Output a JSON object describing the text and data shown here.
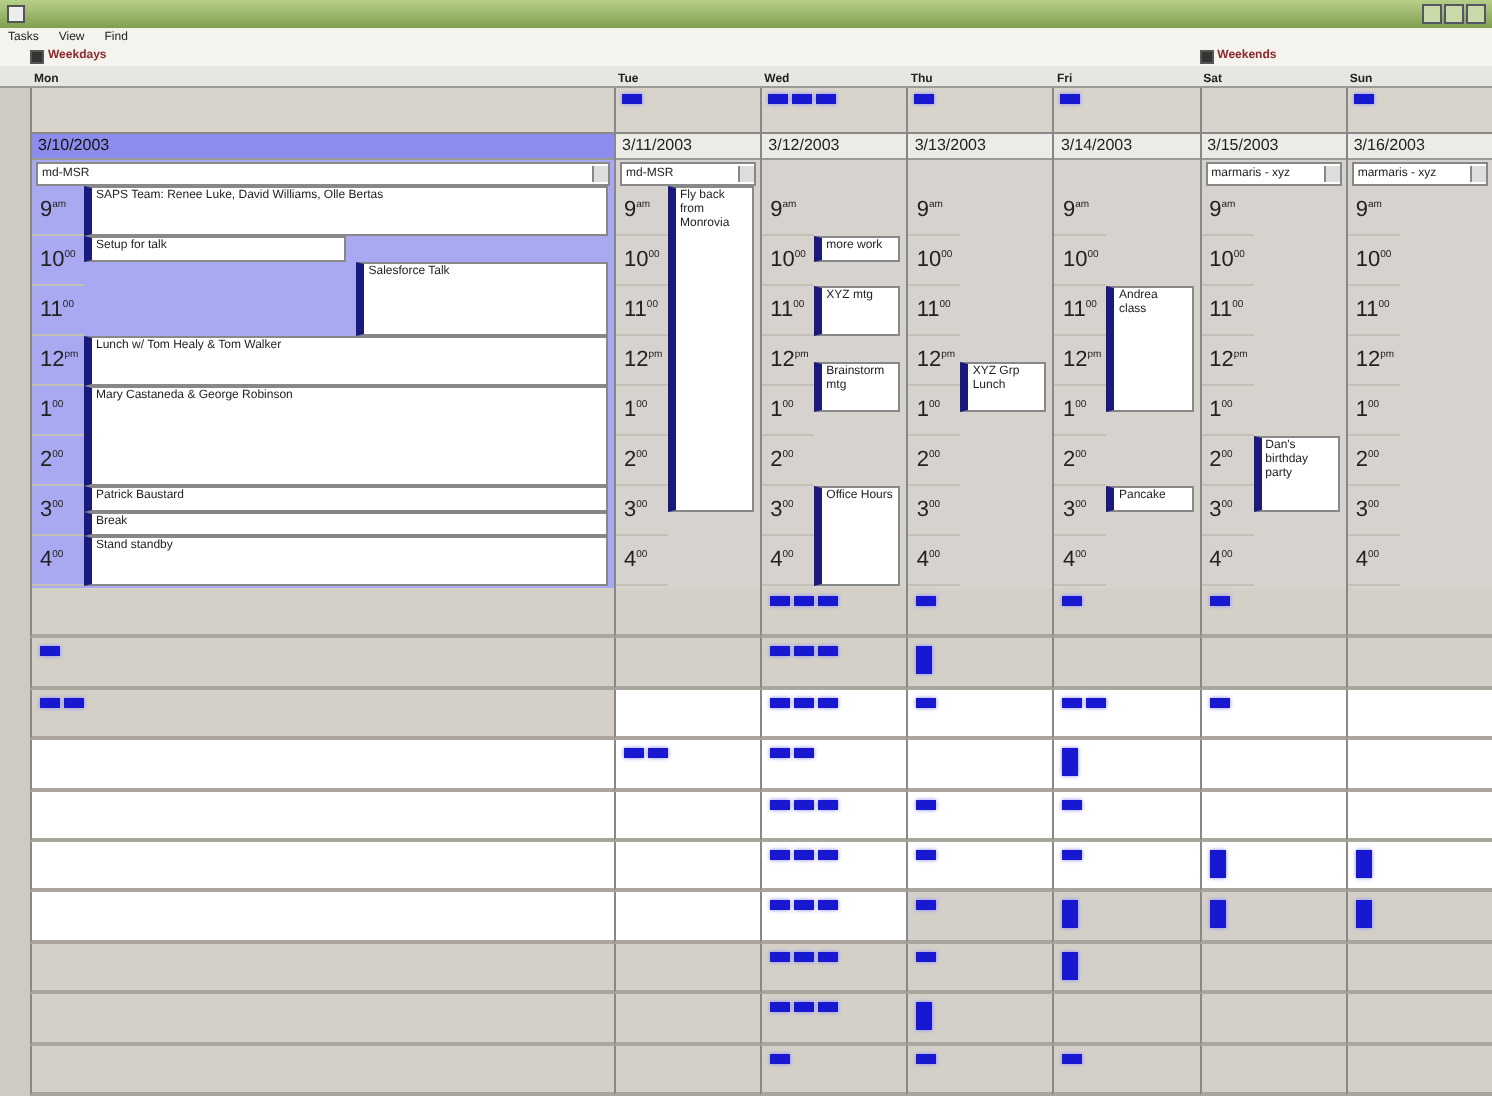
{
  "menu": [
    "Tasks",
    "View",
    "Find"
  ],
  "filters": [
    {
      "label": "Weekdays",
      "checked": true
    },
    {
      "label": "Weekends",
      "checked": true
    }
  ],
  "days": [
    {
      "name": "Mon",
      "date": "3/10/2003",
      "selected": true,
      "field": "md-MSR",
      "hours": [
        "9$^{am}$",
        "10$^{00}$",
        "11$^{00}$",
        "12$^{pm}$",
        "1$^{00}$",
        "2$^{00}$",
        "3$^{00}$",
        "4$^{00}$"
      ],
      "slots": [
        {
          "kind": "event",
          "title": "SAPS Team: Renee Luke, David Williams, Olle Bertas"
        },
        {
          "kind": "more"
        },
        {
          "kind": "half",
          "title": "Setup for talk"
        },
        {
          "kind": "side",
          "title": "Salesforce Talk"
        },
        {
          "kind": "more"
        },
        {
          "kind": "more"
        },
        {
          "kind": "event",
          "title": "Lunch w/ Tom Healy & Tom Walker"
        },
        {
          "kind": "more"
        },
        {
          "kind": "event",
          "title": "Mary Castaneda & George Robinson"
        },
        {
          "kind": "more"
        },
        {
          "kind": "more"
        },
        {
          "kind": "more"
        },
        {
          "kind": "event",
          "title": "Patrick Baustard"
        },
        {
          "kind": "event",
          "title": "Break"
        },
        {
          "kind": "event",
          "title": "Stand standby"
        },
        {
          "kind": "more"
        }
      ]
    },
    {
      "name": "Tue",
      "date": "3/11/2003",
      "selected": false,
      "field": "md-MSR",
      "allday": [
        {
          "kind": "block"
        }
      ],
      "hours": [
        "9$^{am}$",
        "10$^{00}$",
        "11$^{00}$",
        "12$^{pm}$",
        "1$^{00}$",
        "2$^{00}$",
        "3$^{00}$",
        "4$^{00}$"
      ],
      "slots": [
        {
          "kind": "event",
          "title": "Fly back from Monrovia"
        },
        {
          "kind": "more"
        },
        {
          "kind": "more"
        },
        {
          "kind": "more"
        },
        {
          "kind": "more"
        },
        {
          "kind": "more"
        },
        {
          "kind": "more"
        },
        {
          "kind": "more"
        },
        {
          "kind": "more"
        },
        {
          "kind": "more"
        },
        {
          "kind": "more"
        },
        {
          "kind": "more"
        },
        {
          "kind": "more"
        },
        {
          "kind": "free"
        },
        {
          "kind": "free"
        },
        {
          "kind": "free"
        }
      ]
    },
    {
      "name": "Wed",
      "date": "3/12/2003",
      "selected": false,
      "allday": [
        {
          "kind": "block"
        },
        {
          "kind": "block"
        },
        {
          "kind": "block"
        }
      ],
      "hours": [
        "9$^{am}$",
        "10$^{00}$",
        "11$^{00}$",
        "12$^{pm}$",
        "1$^{00}$",
        "2$^{00}$",
        "3$^{00}$",
        "4$^{00}$"
      ],
      "slots": [
        {
          "kind": "free"
        },
        {
          "kind": "free"
        },
        {
          "kind": "event",
          "title": "more work"
        },
        {
          "kind": "free"
        },
        {
          "kind": "event",
          "title": "XYZ mtg"
        },
        {
          "kind": "more"
        },
        {
          "kind": "free"
        },
        {
          "kind": "event",
          "title": "Brainstorm mtg"
        },
        {
          "kind": "more"
        },
        {
          "kind": "free"
        },
        {
          "kind": "free"
        },
        {
          "kind": "free"
        },
        {
          "kind": "event",
          "title": "Office Hours"
        },
        {
          "kind": "more"
        },
        {
          "kind": "more"
        },
        {
          "kind": "more"
        }
      ]
    },
    {
      "name": "Thu",
      "date": "3/13/2003",
      "selected": false,
      "allday": [
        {
          "kind": "block"
        }
      ],
      "hours": [
        "9$^{am}$",
        "10$^{00}$",
        "11$^{00}$",
        "12$^{pm}$",
        "1$^{00}$",
        "2$^{00}$",
        "3$^{00}$",
        "4$^{00}$"
      ],
      "slots": [
        {
          "kind": "free"
        },
        {
          "kind": "free"
        },
        {
          "kind": "free"
        },
        {
          "kind": "free"
        },
        {
          "kind": "free"
        },
        {
          "kind": "free"
        },
        {
          "kind": "free"
        },
        {
          "kind": "event",
          "title": "XYZ Grp Lunch"
        },
        {
          "kind": "more"
        },
        {
          "kind": "free"
        },
        {
          "kind": "free"
        },
        {
          "kind": "free"
        },
        {
          "kind": "free"
        },
        {
          "kind": "free"
        },
        {
          "kind": "free"
        },
        {
          "kind": "free"
        }
      ]
    },
    {
      "name": "Fri",
      "date": "3/14/2003",
      "selected": false,
      "allday": [
        {
          "kind": "block"
        }
      ],
      "hours": [
        "9$^{am}$",
        "10$^{00}$",
        "11$^{00}$",
        "12$^{pm}$",
        "1$^{00}$",
        "2$^{00}$",
        "3$^{00}$",
        "4$^{00}$"
      ],
      "slots": [
        {
          "kind": "free"
        },
        {
          "kind": "free"
        },
        {
          "kind": "free"
        },
        {
          "kind": "free"
        },
        {
          "kind": "event",
          "title": "Andrea class"
        },
        {
          "kind": "more"
        },
        {
          "kind": "more"
        },
        {
          "kind": "more"
        },
        {
          "kind": "more"
        },
        {
          "kind": "free"
        },
        {
          "kind": "free"
        },
        {
          "kind": "free"
        },
        {
          "kind": "event",
          "title": "Pancake"
        },
        {
          "kind": "free"
        },
        {
          "kind": "free"
        },
        {
          "kind": "free"
        }
      ]
    },
    {
      "name": "Sat",
      "date": "3/15/2003",
      "selected": false,
      "field": "marmaris - xyz",
      "hours": [
        "9$^{am}$",
        "10$^{00}$",
        "11$^{00}$",
        "12$^{pm}$",
        "1$^{00}$",
        "2$^{00}$",
        "3$^{00}$",
        "4$^{00}$"
      ],
      "slots": [
        {
          "kind": "free"
        },
        {
          "kind": "free"
        },
        {
          "kind": "free"
        },
        {
          "kind": "free"
        },
        {
          "kind": "free"
        },
        {
          "kind": "free"
        },
        {
          "kind": "free"
        },
        {
          "kind": "free"
        },
        {
          "kind": "free"
        },
        {
          "kind": "free"
        },
        {
          "kind": "event",
          "title": "Dan's birthday party"
        },
        {
          "kind": "more"
        },
        {
          "kind": "more"
        },
        {
          "kind": "free"
        },
        {
          "kind": "free"
        },
        {
          "kind": "free"
        }
      ]
    },
    {
      "name": "Sun",
      "date": "3/16/2003",
      "selected": false,
      "field": "marmaris - xyz",
      "allday": [
        {
          "kind": "block"
        }
      ],
      "hours": [
        "9$^{am}$",
        "10$^{00}$",
        "11$^{00}$",
        "12$^{pm}$",
        "1$^{00}$",
        "2$^{00}$",
        "3$^{00}$",
        "4$^{00}$"
      ]
    }
  ],
  "grid": [
    {
      "cells": [
        {
          "highlighted": false
        },
        {
          "highlighted": false
        },
        {
          "highlighted": false,
          "markers": [
            {
              "kind": "block"
            },
            {
              "kind": "block"
            },
            {
              "kind": "block"
            }
          ]
        },
        {
          "highlighted": false,
          "markers": [
            {
              "kind": "block"
            }
          ]
        },
        {
          "highlighted": false,
          "markers": [
            {
              "kind": "block"
            }
          ]
        },
        {
          "highlighted": false,
          "markers": [
            {
              "kind": "block"
            }
          ]
        },
        {
          "highlighted": false
        }
      ]
    },
    {
      "cells": [
        {
          "highlighted": false,
          "markers": [
            {
              "kind": "block"
            }
          ]
        },
        {
          "highlighted": false
        },
        {
          "highlighted": false,
          "markers": [
            {
              "kind": "block"
            },
            {
              "kind": "block"
            },
            {
              "kind": "block"
            }
          ]
        },
        {
          "highlighted": false,
          "markers": [
            {
              "kind": "tall"
            }
          ]
        },
        {
          "highlighted": false
        },
        {
          "highlighted": false
        },
        {
          "highlighted": false
        }
      ]
    },
    {
      "cells": [
        {
          "highlighted": false,
          "markers": [
            {
              "kind": "block"
            },
            {
              "kind": "block"
            }
          ]
        },
        {
          "highlighted": true
        },
        {
          "highlighted": true,
          "markers": [
            {
              "kind": "block"
            },
            {
              "kind": "block"
            },
            {
              "kind": "block"
            }
          ]
        },
        {
          "highlighted": true,
          "markers": [
            {
              "kind": "block"
            }
          ]
        },
        {
          "highlighted": true,
          "markers": [
            {
              "kind": "block"
            },
            {
              "kind": "block"
            }
          ]
        },
        {
          "highlighted": true,
          "markers": [
            {
              "kind": "block"
            }
          ]
        },
        {
          "highlighted": true
        }
      ]
    },
    {
      "cells": [
        {
          "highlighted": true
        },
        {
          "highlighted": true,
          "markers": [
            {
              "kind": "block"
            },
            {
              "kind": "block"
            }
          ]
        },
        {
          "highlighted": true,
          "markers": [
            {
              "kind": "block"
            },
            {
              "kind": "block"
            }
          ]
        },
        {
          "highlighted": true
        },
        {
          "highlighted": true,
          "markers": [
            {
              "kind": "tall"
            }
          ]
        },
        {
          "highlighted": true
        },
        {
          "highlighted": true
        }
      ]
    },
    {
      "cells": [
        {
          "highlighted": true
        },
        {
          "highlighted": true
        },
        {
          "highlighted": true,
          "markers": [
            {
              "kind": "block"
            },
            {
              "kind": "block"
            },
            {
              "kind": "block"
            }
          ]
        },
        {
          "highlighted": true,
          "markers": [
            {
              "kind": "block"
            }
          ]
        },
        {
          "highlighted": true,
          "markers": [
            {
              "kind": "block"
            }
          ]
        },
        {
          "highlighted": true
        },
        {
          "highlighted": true
        }
      ]
    },
    {
      "cells": [
        {
          "highlighted": true
        },
        {
          "highlighted": true
        },
        {
          "highlighted": true,
          "markers": [
            {
              "kind": "block"
            },
            {
              "kind": "block"
            },
            {
              "kind": "block"
            }
          ]
        },
        {
          "highlighted": true,
          "markers": [
            {
              "kind": "block"
            }
          ]
        },
        {
          "highlighted": true,
          "markers": [
            {
              "kind": "block"
            }
          ]
        },
        {
          "highlighted": true,
          "markers": [
            {
              "kind": "tall"
            }
          ]
        },
        {
          "highlighted": true,
          "markers": [
            {
              "kind": "tall"
            }
          ]
        }
      ]
    },
    {
      "cells": [
        {
          "highlighted": true
        },
        {
          "highlighted": true
        },
        {
          "highlighted": true,
          "markers": [
            {
              "kind": "block"
            },
            {
              "kind": "block"
            },
            {
              "kind": "block"
            }
          ]
        },
        {
          "highlighted": false,
          "markers": [
            {
              "kind": "block"
            }
          ]
        },
        {
          "highlighted": false,
          "markers": [
            {
              "kind": "tall"
            }
          ]
        },
        {
          "highlighted": false,
          "markers": [
            {
              "kind": "tall"
            }
          ]
        },
        {
          "highlighted": false,
          "markers": [
            {
              "kind": "tall"
            }
          ]
        }
      ]
    },
    {
      "cells": [
        {
          "highlighted": false
        },
        {
          "highlighted": false
        },
        {
          "highlighted": false,
          "markers": [
            {
              "kind": "block"
            },
            {
              "kind": "block"
            },
            {
              "kind": "block"
            }
          ]
        },
        {
          "highlighted": false,
          "markers": [
            {
              "kind": "block"
            }
          ]
        },
        {
          "highlighted": false,
          "markers": [
            {
              "kind": "tall"
            }
          ]
        },
        {
          "highlighted": false
        },
        {
          "highlighted": false
        }
      ]
    },
    {
      "cells": [
        {
          "highlighted": false
        },
        {
          "highlighted": false
        },
        {
          "highlighted": false,
          "markers": [
            {
              "kind": "block"
            },
            {
              "kind": "block"
            },
            {
              "kind": "block"
            }
          ]
        },
        {
          "highlighted": false,
          "markers": [
            {
              "kind": "tall"
            }
          ]
        },
        {
          "highlighted": false
        },
        {
          "highlighted": false
        },
        {
          "highlighted": false
        }
      ]
    },
    {
      "cells": [
        {
          "highlighted": false
        },
        {
          "highlighted": false
        },
        {
          "highlighted": false,
          "markers": [
            {
              "kind": "block"
            }
          ]
        },
        {
          "highlighted": false,
          "markers": [
            {
              "kind": "block"
            }
          ]
        },
        {
          "highlighted": false,
          "markers": [
            {
              "kind": "block"
            }
          ]
        },
        {
          "highlighted": false
        },
        {
          "highlighted": false
        }
      ]
    }
  ]
}
